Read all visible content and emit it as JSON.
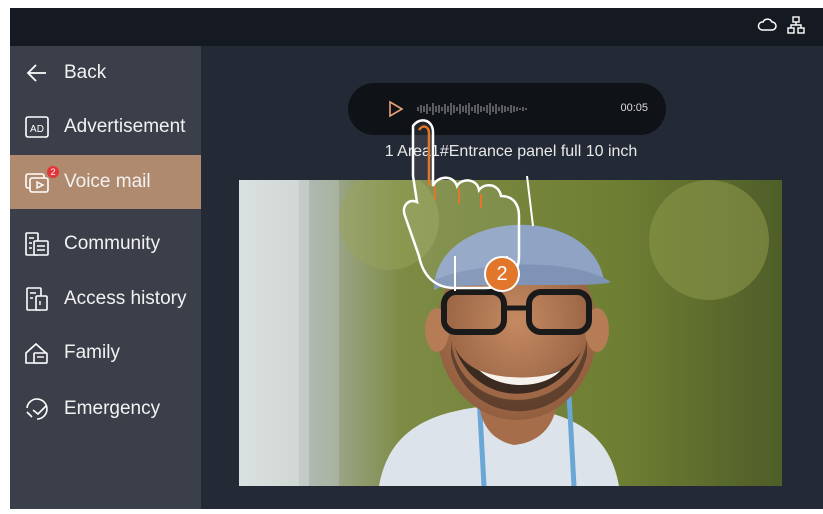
{
  "status_bar": {
    "icons": [
      "cloud-icon",
      "network-icon"
    ]
  },
  "sidebar": {
    "items": [
      {
        "label": "Back",
        "icon": "arrow-left-icon"
      },
      {
        "label": "Advertisement",
        "icon": "ad-icon"
      },
      {
        "label": "Voice mail",
        "icon": "voice-mail-icon",
        "badge": "2",
        "active": true
      },
      {
        "label": "Community",
        "icon": "community-icon"
      },
      {
        "label": "Access history",
        "icon": "access-history-icon"
      },
      {
        "label": "Family",
        "icon": "family-icon"
      },
      {
        "label": "Emergency",
        "icon": "emergency-icon"
      }
    ]
  },
  "player": {
    "duration": "00:05",
    "icon": "play-icon"
  },
  "message": {
    "source": "1 Area1#Entrance panel full 10 inch"
  },
  "overlay": {
    "step_number": "2",
    "icon": "pointing-hand-icon"
  },
  "colors": {
    "active_item": "#b08a6e",
    "accent": "#e2762a",
    "badge": "#e3343a"
  }
}
